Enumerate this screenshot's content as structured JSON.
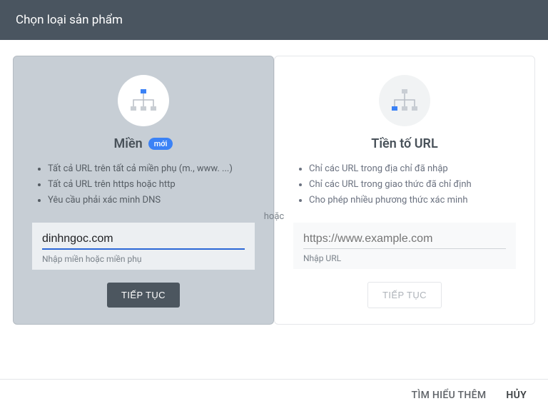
{
  "header": {
    "title": "Chọn loại sản phẩm"
  },
  "or_label": "hoặc",
  "domain_card": {
    "title": "Miền",
    "badge": "mới",
    "bullets": [
      "Tất cả URL trên tất cả miền phụ (m., www. ...)",
      "Tất cả URL trên https hoặc http",
      "Yêu cầu phải xác minh DNS"
    ],
    "input_value": "dinhngoc.com",
    "input_helper": "Nhập miền hoặc miền phụ",
    "button": "TIẾP TỤC"
  },
  "url_card": {
    "title": "Tiền tố URL",
    "bullets": [
      "Chỉ các URL trong địa chỉ đã nhập",
      "Chỉ các URL trong giao thức đã chỉ định",
      "Cho phép nhiều phương thức xác minh"
    ],
    "input_placeholder": "https://www.example.com",
    "input_helper": "Nhập URL",
    "button": "TIẾP TỤC"
  },
  "footer": {
    "learn_more": "TÌM HIỂU THÊM",
    "cancel": "HỦY"
  }
}
